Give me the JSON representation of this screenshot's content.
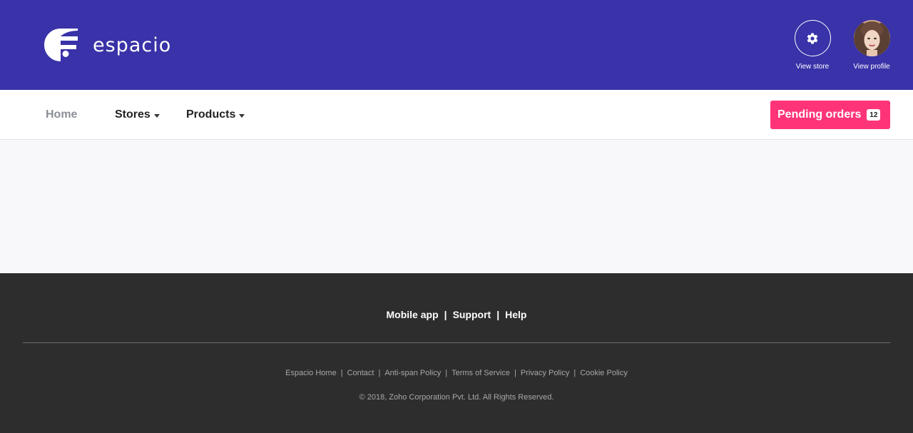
{
  "brand": {
    "name": "espacio",
    "logo_icon": "espacio-logo-icon"
  },
  "header_actions": {
    "view_store": {
      "label": "View store",
      "icon": "gear-icon"
    },
    "view_profile": {
      "label": "View profile",
      "icon": "avatar"
    }
  },
  "nav": {
    "home": "Home",
    "stores": "Stores",
    "products": "Products"
  },
  "pending_orders": {
    "label": "Pending orders",
    "count": "12"
  },
  "footer": {
    "primary_links": [
      "Mobile app",
      "Support",
      "Help"
    ],
    "legal_links": [
      "Espacio Home",
      "Contact",
      "Anti-span Policy",
      "Terms of Service",
      "Privacy Policy",
      "Cookie Policy"
    ],
    "copyright": "© 2018, Zoho Corporation Pvt. Ltd. All Rights Reserved."
  },
  "colors": {
    "header_bg": "#3932a8",
    "accent": "#ff3478",
    "footer_bg": "#2d2d2d"
  }
}
